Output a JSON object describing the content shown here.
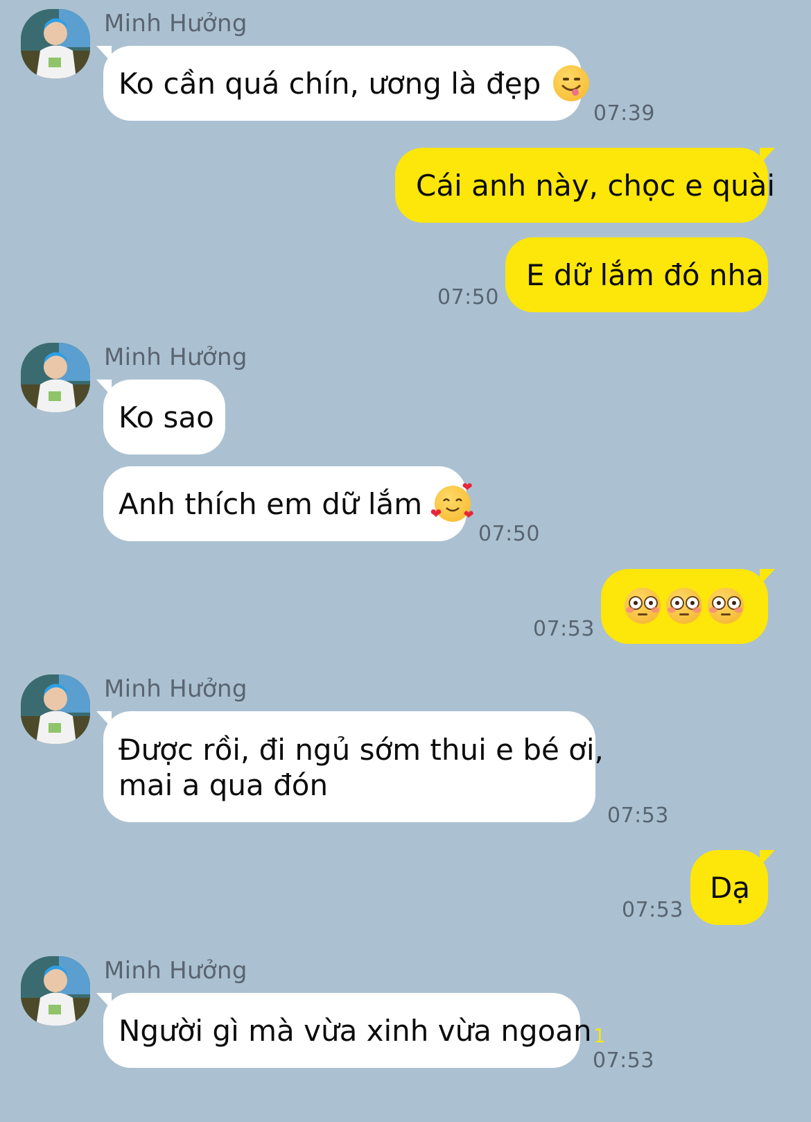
{
  "chat": {
    "contact_name": "Minh Hưởng",
    "messages": [
      {
        "side": "in",
        "text": "Ko cần quá chín, ương là đẹp",
        "emoji": "yum-face-emoji",
        "time": "07:39",
        "show_sender": true
      },
      {
        "side": "out",
        "text": "Cái anh này, chọc e quài",
        "time": ""
      },
      {
        "side": "out",
        "text": "E dữ lắm đó nha",
        "time": "07:50"
      },
      {
        "side": "in",
        "text": "Ko sao",
        "time": "",
        "show_sender": true
      },
      {
        "side": "in",
        "text": "Anh thích em dữ lắm",
        "emoji": "smiling-hearts-emoji",
        "time": "07:50"
      },
      {
        "side": "out",
        "text": "",
        "emoji": "flushed-face-emoji x3",
        "time": "07:53"
      },
      {
        "side": "in",
        "line1": "Được rồi, đi ngủ sớm thui e bé ơi,",
        "line2": "mai a qua đón",
        "time": "07:53",
        "show_sender": true
      },
      {
        "side": "out",
        "text": "Dạ",
        "time": "07:53"
      },
      {
        "side": "in",
        "text": "Người gì mà vừa xinh vừa ngoan",
        "time": "07:53",
        "unread_count": "1",
        "show_sender": true
      }
    ]
  },
  "colors": {
    "background": "#abc1d1",
    "incoming_bubble": "#ffffff",
    "outgoing_bubble": "#fde60a",
    "unread": "#f6e70e"
  }
}
